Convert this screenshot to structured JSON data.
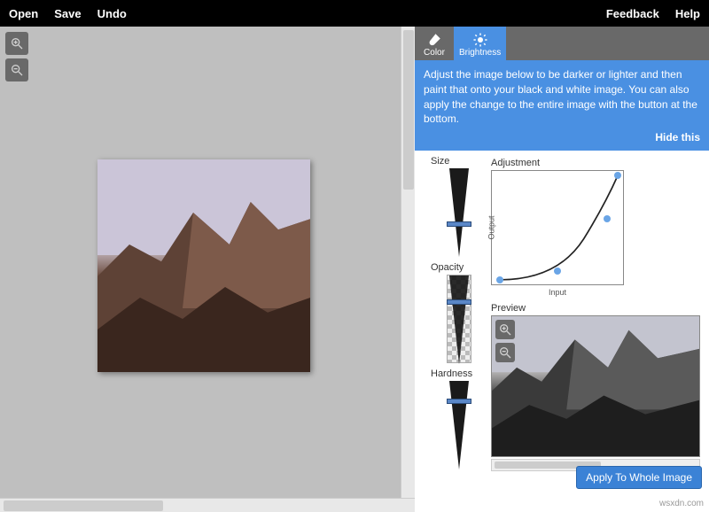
{
  "topbar": {
    "left": [
      "Open",
      "Save",
      "Undo"
    ],
    "right": [
      "Feedback",
      "Help"
    ]
  },
  "tabs": {
    "color": "Color",
    "brightness": "Brightness",
    "active": "brightness"
  },
  "info": {
    "text": "Adjust the image below to be darker or lighter and then paint that onto your black and white image. You can also apply the change to the entire image with the button at the bottom.",
    "hide": "Hide this"
  },
  "sliders": {
    "size": {
      "label": "Size",
      "handle_pct": 60
    },
    "opacity": {
      "label": "Opacity",
      "handle_pct": 28
    },
    "hardness": {
      "label": "Hardness",
      "handle_pct": 20
    }
  },
  "adjustment": {
    "label": "Adjustment",
    "y_axis": "Output",
    "x_axis": "Input",
    "points": [
      {
        "x_pct": 6,
        "y_pct": 96
      },
      {
        "x_pct": 50,
        "y_pct": 88
      },
      {
        "x_pct": 88,
        "y_pct": 42
      },
      {
        "x_pct": 96,
        "y_pct": 4
      }
    ]
  },
  "preview": {
    "label": "Preview"
  },
  "apply_button": "Apply To Whole Image",
  "watermark": "wsxdn.com",
  "colors": {
    "accent": "#4a90e2",
    "button": "#3b82d6"
  }
}
